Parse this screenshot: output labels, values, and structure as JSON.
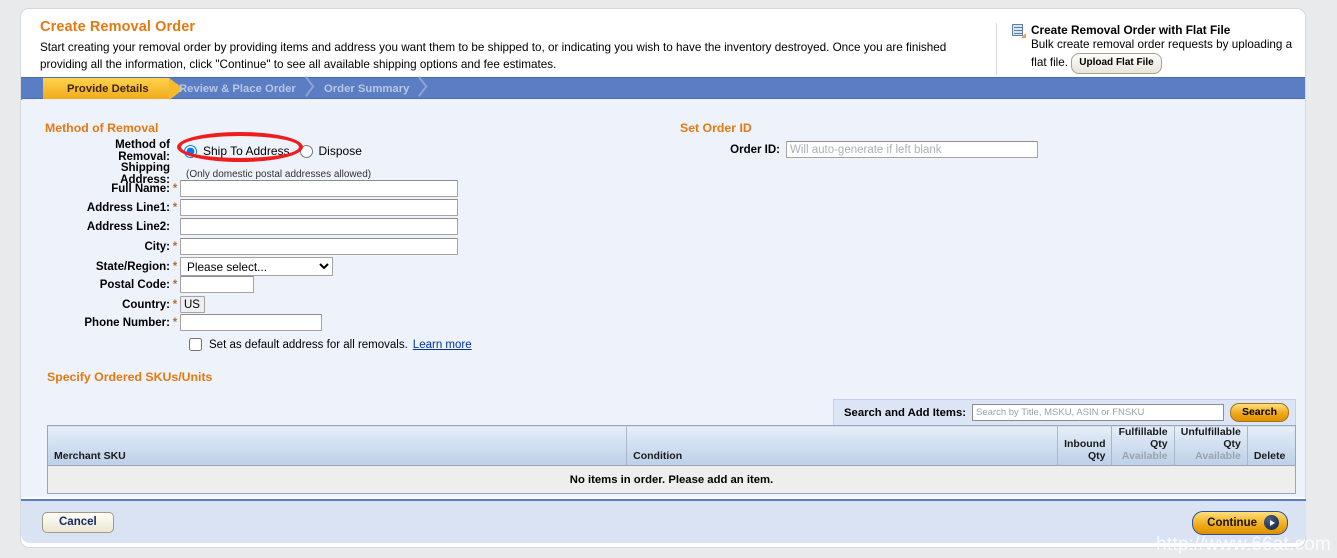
{
  "header": {
    "title": "Create Removal Order",
    "description": "Start creating your removal order by providing items and address you want them to be shipped to, or indicating you wish to have the inventory destroyed. Once you are finished providing all the information, click \"Continue\" to see all available shipping options and fee estimates.",
    "flat_file": {
      "icon": "spreadsheet-upload-icon",
      "title": "Create Removal Order with Flat File",
      "description": "Bulk create removal order requests by uploading a flat file.",
      "button_label": "Upload Flat File"
    }
  },
  "wizard": {
    "steps": [
      {
        "label": "Provide Details",
        "active": true
      },
      {
        "label": "Review & Place Order",
        "active": false
      },
      {
        "label": "Order Summary",
        "active": false
      }
    ]
  },
  "method_section": {
    "title": "Method of Removal",
    "field_label": "Method of Removal:",
    "options": [
      {
        "label": "Ship To Address",
        "selected": true
      },
      {
        "label": "Dispose",
        "selected": false
      }
    ],
    "shipping_address_label": "Shipping Address:",
    "shipping_address_note": "(Only domestic postal addresses allowed)",
    "fields": [
      {
        "label": "Full Name:",
        "required": true,
        "value": "",
        "type": "text"
      },
      {
        "label": "Address Line1:",
        "required": true,
        "value": "",
        "type": "text"
      },
      {
        "label": "Address Line2:",
        "required": false,
        "value": "",
        "type": "text"
      },
      {
        "label": "City:",
        "required": true,
        "value": "",
        "type": "text"
      },
      {
        "label": "State/Region:",
        "required": true,
        "value": "Please select...",
        "type": "select"
      },
      {
        "label": "Postal Code:",
        "required": true,
        "value": "",
        "type": "text"
      },
      {
        "label": "Country:",
        "required": true,
        "value": "US",
        "type": "readonly"
      },
      {
        "label": "Phone Number:",
        "required": true,
        "value": "",
        "type": "text"
      }
    ],
    "default_address_checkbox": {
      "checked": false,
      "label": "Set as default address for all removals.",
      "link_label": "Learn more"
    }
  },
  "order_id_section": {
    "title": "Set Order ID",
    "field_label": "Order ID:",
    "value": "",
    "placeholder": "Will auto-generate if left blank"
  },
  "skus_section": {
    "title": "Specify Ordered SKUs/Units",
    "search": {
      "label": "Search and Add Items:",
      "value": "",
      "placeholder": "Search by Title, MSKU, ASIN or FNSKU",
      "button_label": "Search"
    },
    "table": {
      "columns": [
        {
          "label": "Merchant SKU",
          "sub": "",
          "align": "left"
        },
        {
          "label": "Condition",
          "sub": "",
          "align": "left"
        },
        {
          "label": "Inbound Qty",
          "sub": "",
          "align": "right"
        },
        {
          "label": "Fulfillable Qty",
          "sub": "Available",
          "align": "right"
        },
        {
          "label": "Unfulfillable Qty",
          "sub": "Available",
          "align": "right"
        },
        {
          "label": "Delete",
          "sub": "",
          "align": "left"
        }
      ],
      "rows": [],
      "empty_message": "No items in order. Please add an item."
    }
  },
  "footer": {
    "cancel_label": "Cancel",
    "continue_label": "Continue"
  },
  "watermark": "http://www.66at.com",
  "colors": {
    "accent_orange": "#e47911",
    "tab_blue": "#5b7dc4",
    "body_blue": "#eef2fa",
    "annotation_red": "#ef1d1d",
    "link_blue": "#00339a"
  }
}
